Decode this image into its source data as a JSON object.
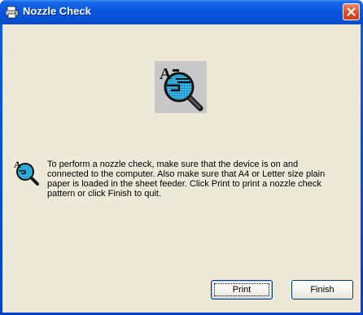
{
  "window": {
    "title": "Nozzle Check",
    "title_icon": "printer-icon",
    "close_icon": "close-icon"
  },
  "content": {
    "hero_icon": "magnifier-nozzle-icon",
    "info_icon": "nozzle-check-small-icon",
    "message": "To perform a nozzle check, make sure that the device is on and connected to the computer. Also make sure that A4 or Letter size plain paper is loaded in the sheet feeder. Click Print to print a nozzle check pattern or click Finish to quit."
  },
  "buttons": {
    "print_label": "Print",
    "finish_label": "Finish"
  },
  "colors": {
    "titlebar": "#0a58e0",
    "client_bg": "#ece9d8",
    "close_button": "#d8542e"
  }
}
